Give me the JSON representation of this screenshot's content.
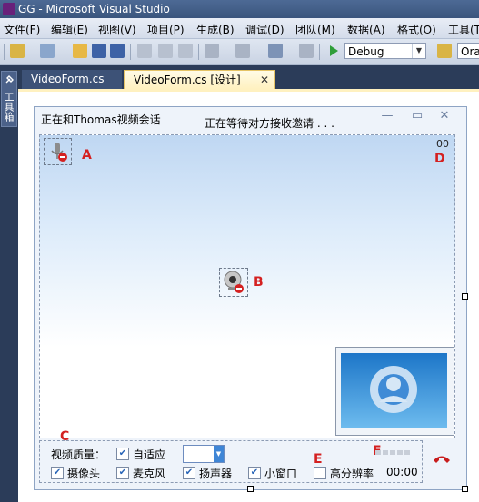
{
  "window": {
    "title": "GG - Microsoft Visual Studio"
  },
  "menu": [
    {
      "label": "文件(F)"
    },
    {
      "label": "编辑(E)"
    },
    {
      "label": "视图(V)"
    },
    {
      "label": "项目(P)"
    },
    {
      "label": "生成(B)"
    },
    {
      "label": "调试(D)"
    },
    {
      "label": "团队(M)"
    },
    {
      "label": "数据(A)"
    },
    {
      "label": "格式(O)"
    },
    {
      "label": "工具(T"
    }
  ],
  "toolbar": {
    "config_value": "Debug",
    "platform_value": "Ora"
  },
  "toolbox": {
    "label": "工具箱"
  },
  "tabs": [
    {
      "label": "VideoForm.cs"
    },
    {
      "label": "VideoForm.cs [设计]",
      "close": "✕"
    }
  ],
  "form": {
    "title": "正在和Thomas视频会话",
    "status": "正在等待对方接收邀请 . . .",
    "counter": "00",
    "labels": {
      "a": "A",
      "b": "B",
      "c": "C",
      "d": "D",
      "e": "E",
      "f": "F"
    },
    "controls": {
      "quality_label": "视频质量：",
      "adaptive": "自适应",
      "camera": "摄像头",
      "microphone": "麦克风",
      "speaker": "扬声器",
      "small_window": "小窗口",
      "high_res": "高分辨率",
      "time": "00:00"
    }
  },
  "colors": {
    "accent_red": "#d42020",
    "vs_dark": "#2b3c59",
    "active_tab": "#fff1c0"
  },
  "icons": [
    "app-icon",
    "new-project-icon",
    "add-item-icon",
    "open-file-icon",
    "save-icon",
    "save-all-icon",
    "cut-icon",
    "copy-icon",
    "paste-icon",
    "undo-icon",
    "redo-icon",
    "start-debug-icon",
    "microphone-icon",
    "camera-icon",
    "hangup-icon",
    "signal-bars-icon"
  ]
}
